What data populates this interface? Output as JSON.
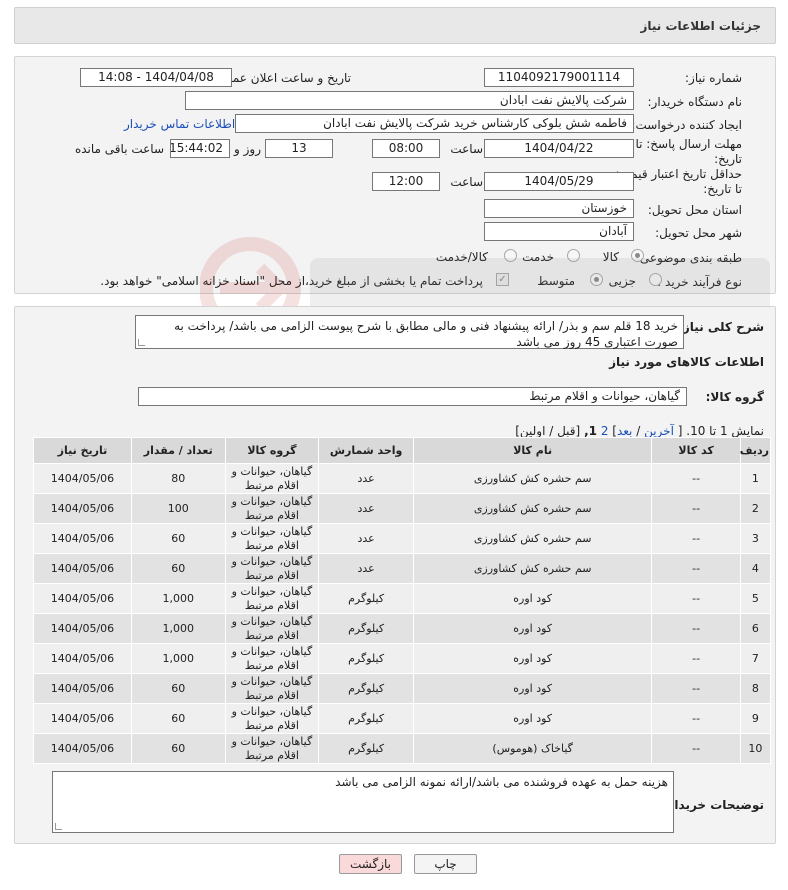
{
  "header": {
    "title": "جزئیات اطلاعات نیاز"
  },
  "form": {
    "need_number_label": "شماره نیاز:",
    "need_number": "1104092179001114",
    "announce_label": "تاریخ و ساعت اعلان عمومی:",
    "announce_value": "1404/04/08 - 14:08",
    "buyer_org_label": "نام دستگاه خریدار:",
    "buyer_org": "شرکت پالایش نفت ابادان",
    "creator_label": "ایجاد کننده درخواست:",
    "creator": "فاطمه شش بلوکی کارشناس خرید شرکت پالایش نفت ابادان",
    "contact_link": "اطلاعات تماس خریدار",
    "deadline_label_line1": "مهلت ارسال پاسخ: تا",
    "deadline_label_line2": "تاریخ:",
    "deadline_date": "1404/04/22",
    "time_label": "ساعت",
    "deadline_time": "08:00",
    "days_value": "13",
    "days_label": "روز و",
    "remaining_time": "15:44:02",
    "remaining_label": "ساعت باقی مانده",
    "validity_label_line1": "حداقل تاریخ اعتبار قیمت:",
    "validity_label_line2": "تا تاریخ:",
    "validity_date": "1404/05/29",
    "validity_time_label": "ساعت",
    "validity_time": "12:00",
    "province_label": "استان محل تحویل:",
    "province": "خوزستان",
    "city_label": "شهر محل تحویل:",
    "city": "آبادان",
    "category_label": "طبقه بندی موضوعی:",
    "category_options": [
      "کالا",
      "خدمت",
      "کالا/خدمت"
    ],
    "category_selected": "کالا",
    "process_label": "نوع فرآیند خرید :",
    "process_options": [
      "جزیی",
      "متوسط"
    ],
    "payment_note": "پرداخت تمام یا بخشی از مبلغ خرید،از محل \"اسناد خزانه اسلامی\" خواهد بود."
  },
  "details": {
    "description_label": "شرح کلی نیاز:",
    "description": "خرید 18 قلم سم و بذر/ ارائه پیشنهاد فنی و مالی مطابق با شرح پیوست الزامی می باشد/ پرداخت به صورت اعتباری 45 روز می باشد",
    "goods_info_title": "اطلاعات کالاهای مورد نیاز",
    "goods_group_label": "گروه کالا:",
    "goods_group": "گیاهان، حیوانات و اقلام مرتبط",
    "pagination": {
      "prefix": "نمایش 1 تا 10. [",
      "last": "آخرین",
      "sep1": " / ",
      "next": "بعد",
      "page2": "2",
      "page1": "1,",
      "suffix": "[قبل / اولین]"
    },
    "table": {
      "headers": [
        "ردیف",
        "کد کالا",
        "نام کالا",
        "واحد شمارش",
        "گروه کالا",
        "تعداد / مقدار",
        "تاریخ نیاز"
      ],
      "rows": [
        {
          "row": "1",
          "code": "--",
          "name": "سم حشره کش کشاورزی",
          "unit": "عدد",
          "group": "گیاهان، حیوانات و اقلام مرتبط",
          "qty": "80",
          "date": "1404/05/06"
        },
        {
          "row": "2",
          "code": "--",
          "name": "سم حشره کش کشاورزی",
          "unit": "عدد",
          "group": "گیاهان، حیوانات و اقلام مرتبط",
          "qty": "100",
          "date": "1404/05/06"
        },
        {
          "row": "3",
          "code": "--",
          "name": "سم حشره کش کشاورزی",
          "unit": "عدد",
          "group": "گیاهان، حیوانات و اقلام مرتبط",
          "qty": "60",
          "date": "1404/05/06"
        },
        {
          "row": "4",
          "code": "--",
          "name": "سم حشره کش کشاورزی",
          "unit": "عدد",
          "group": "گیاهان، حیوانات و اقلام مرتبط",
          "qty": "60",
          "date": "1404/05/06"
        },
        {
          "row": "5",
          "code": "--",
          "name": "کود اوره",
          "unit": "کیلوگرم",
          "group": "گیاهان، حیوانات و اقلام مرتبط",
          "qty": "1,000",
          "date": "1404/05/06"
        },
        {
          "row": "6",
          "code": "--",
          "name": "کود اوره",
          "unit": "کیلوگرم",
          "group": "گیاهان، حیوانات و اقلام مرتبط",
          "qty": "1,000",
          "date": "1404/05/06"
        },
        {
          "row": "7",
          "code": "--",
          "name": "کود اوره",
          "unit": "کیلوگرم",
          "group": "گیاهان، حیوانات و اقلام مرتبط",
          "qty": "1,000",
          "date": "1404/05/06"
        },
        {
          "row": "8",
          "code": "--",
          "name": "کود اوره",
          "unit": "کیلوگرم",
          "group": "گیاهان، حیوانات و اقلام مرتبط",
          "qty": "60",
          "date": "1404/05/06"
        },
        {
          "row": "9",
          "code": "--",
          "name": "کود اوره",
          "unit": "کیلوگرم",
          "group": "گیاهان، حیوانات و اقلام مرتبط",
          "qty": "60",
          "date": "1404/05/06"
        },
        {
          "row": "10",
          "code": "--",
          "name": "گیاخاک (هوموس)",
          "unit": "کیلوگرم",
          "group": "گیاهان، حیوانات و اقلام مرتبط",
          "qty": "60",
          "date": "1404/05/06"
        }
      ]
    },
    "buyer_notes_label": "توضیحات خریدار:",
    "buyer_notes": "هزینه حمل به عهده فروشنده می باشد/ارائه نمونه الزامی می باشد"
  },
  "buttons": {
    "print": "چاپ",
    "back": "بازگشت"
  },
  "colors": {
    "link": "#1a4fb8",
    "back_button": "#f9d9d9",
    "header_bg": "#e8e8e8"
  }
}
